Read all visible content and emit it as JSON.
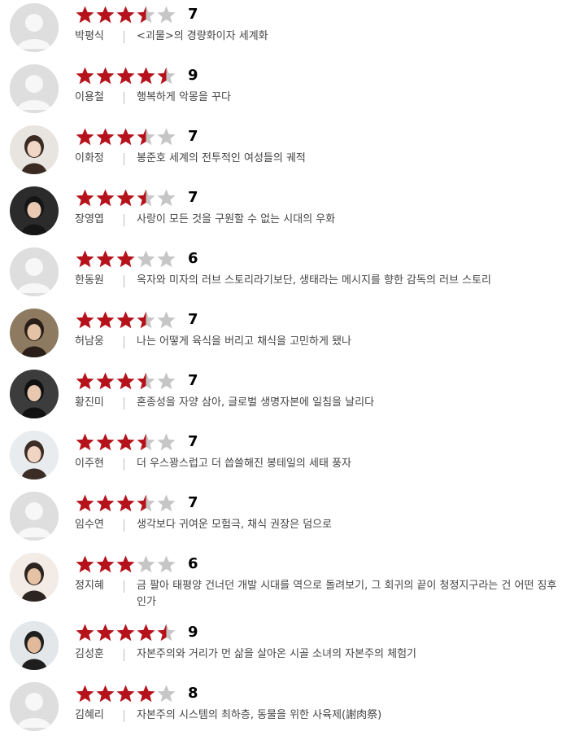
{
  "reviews": [
    {
      "name": "박평식",
      "score": "7",
      "rating": 3.5,
      "comment": "<괴물>의 경량화이자 세계화",
      "avatar": "default-avatar"
    },
    {
      "name": "이용철",
      "score": "9",
      "rating": 4.5,
      "comment": "행복하게 악몽을 꾸다",
      "avatar": "default-avatar"
    },
    {
      "name": "이화정",
      "score": "7",
      "rating": 3.5,
      "comment": "봉준호 세계의 전투적인 여성들의 궤적",
      "avatar": "photo-avatar"
    },
    {
      "name": "장영엽",
      "score": "7",
      "rating": 3.5,
      "comment": "사랑이 모든 것을 구원할 수 없는 시대의 우화",
      "avatar": "photo-avatar"
    },
    {
      "name": "한동원",
      "score": "6",
      "rating": 3,
      "comment": "옥자와 미자의 러브 스토리라기보단, 생태라는 메시지를 향한 감독의 러브 스토리",
      "avatar": "default-avatar"
    },
    {
      "name": "허남웅",
      "score": "7",
      "rating": 3.5,
      "comment": "나는 어떻게 육식을 버리고 채식을 고민하게 됐나",
      "avatar": "photo-avatar"
    },
    {
      "name": "황진미",
      "score": "7",
      "rating": 3.5,
      "comment": "혼종성을 자양 삼아, 글로벌 생명자본에 일침을 날리다",
      "avatar": "photo-avatar"
    },
    {
      "name": "이주현",
      "score": "7",
      "rating": 3.5,
      "comment": "더 우스꽝스럽고 더 씁쓸해진 봉테일의 세태 풍자",
      "avatar": "photo-avatar"
    },
    {
      "name": "임수연",
      "score": "7",
      "rating": 3.5,
      "comment": "생각보다 귀여운 모험극, 채식 권장은 덤으로",
      "avatar": "default-avatar"
    },
    {
      "name": "정지혜",
      "score": "6",
      "rating": 3,
      "comment": "금 팔아 태평양 건너던 개발 시대를 역으로 돌려보기, 그 회귀의 끝이 청정지구라는 건 어떤 징후인가",
      "avatar": "photo-avatar"
    },
    {
      "name": "김성훈",
      "score": "9",
      "rating": 4.5,
      "comment": "자본주의와 거리가 먼 삶을 살아온 시골 소녀의 자본주의 체험기",
      "avatar": "photo-avatar"
    },
    {
      "name": "김혜리",
      "score": "8",
      "rating": 4,
      "comment": "자본주의 시스템의 최하층, 동물을 위한 사육제(謝肉祭)",
      "avatar": "default-avatar"
    }
  ],
  "colors": {
    "star_on": "#b5121b",
    "star_off": "#c6c6c6"
  }
}
